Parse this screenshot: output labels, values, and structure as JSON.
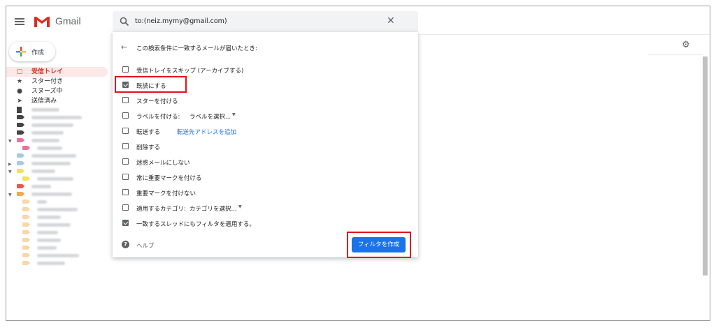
{
  "app": {
    "name": "Gmail",
    "compose_label": "作成"
  },
  "sidebar": {
    "items": [
      {
        "label": "受信トレイ",
        "icon": "inbox-icon",
        "active": true
      },
      {
        "label": "スター付き",
        "icon": "star-icon"
      },
      {
        "label": "スヌーズ中",
        "icon": "clock-icon"
      },
      {
        "label": "送信済み",
        "icon": "send-icon"
      }
    ],
    "label_colors": [
      "#444444",
      "#444444",
      "#444444",
      "#444444",
      "#e8739a",
      "#e8739a",
      "#a8c8e8",
      "#a8c8e8",
      "#a8c8e8",
      "#f2e15b",
      "#f2e15b",
      "#e9564a",
      "#f4a84a",
      "#f9d7a8"
    ]
  },
  "search": {
    "query": "to:(neiz.mymy@gmail.com)"
  },
  "filter": {
    "title": "この検索条件に一致するメールが届いたとき:",
    "options": [
      {
        "label": "受信トレイをスキップ (アーカイブする)",
        "checked": false
      },
      {
        "label": "既読にする",
        "checked": true
      },
      {
        "label": "スターを付ける",
        "checked": false
      },
      {
        "label": "ラベルを付ける:",
        "select": "ラベルを選択...",
        "checked": false
      },
      {
        "label": "転送する",
        "link": "転送先アドレスを追加",
        "checked": false
      },
      {
        "label": "削除する",
        "checked": false
      },
      {
        "label": "迷惑メールにしない",
        "checked": false
      },
      {
        "label": "常に重要マークを付ける",
        "checked": false
      },
      {
        "label": "重要マークを付けない",
        "checked": false
      },
      {
        "label": "適用するカテゴリ:",
        "select": "カテゴリを選択...",
        "checked": false
      },
      {
        "label": "一致するスレッドにもフィルタを適用する。",
        "checked": true
      }
    ],
    "help_label": "ヘルプ",
    "create_button": "フィルタを作成"
  },
  "colors": {
    "accent": "#1a73e8",
    "highlight": "#e0121c",
    "gmail_red": "#d93025"
  }
}
